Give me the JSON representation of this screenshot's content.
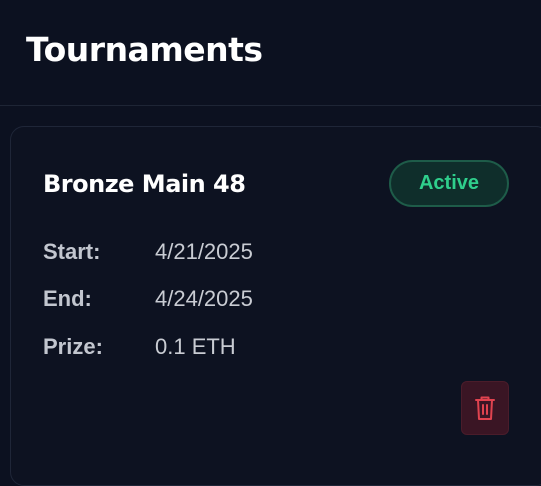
{
  "header": {
    "title": "Tournaments"
  },
  "tournament": {
    "name": "Bronze Main 48",
    "status": "Active",
    "status_color": "#2fcf8c",
    "fields": {
      "start_label": "Start:",
      "start_value": "4/21/2025",
      "end_label": "End:",
      "end_value": "4/24/2025",
      "prize_label": "Prize:",
      "prize_value": "0.1 ETH"
    },
    "delete_icon": "trash-icon",
    "delete_color": "#e0434f"
  }
}
